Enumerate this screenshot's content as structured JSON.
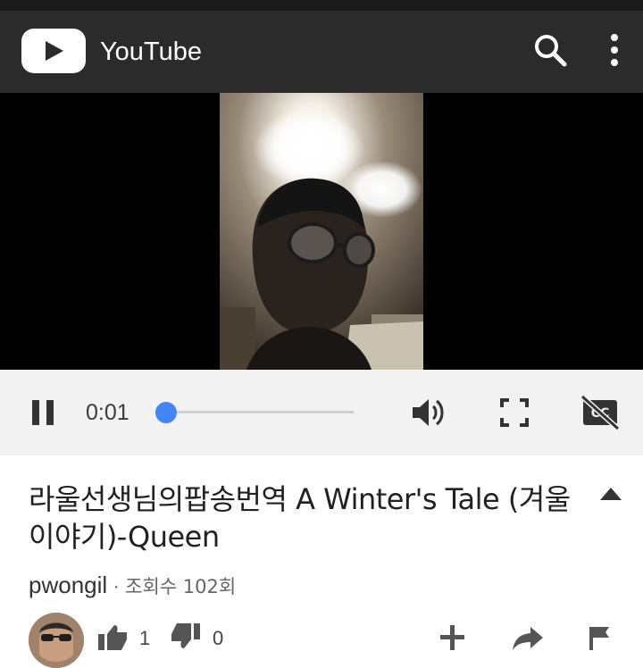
{
  "app_bar": {
    "title": "YouTube",
    "logo_icon": "youtube-play-icon",
    "search_icon": "search-icon",
    "more_icon": "more-vert-icon",
    "background": "#2b2b2b"
  },
  "player": {
    "current_time": "0:01",
    "progress": 0.0,
    "accent": "#4285f4",
    "pause_icon": "pause-icon",
    "volume_icon": "volume-icon",
    "fullscreen_icon": "fullscreen-icon",
    "captions_icon": "captions-off-icon"
  },
  "video": {
    "title": "라울선생님의팝송번역 A Winter's Tale (겨울이야기)-Queen",
    "channel": "pwongil",
    "separator": "·",
    "views": "조회수 102회"
  },
  "actions": {
    "likes": "1",
    "dislikes": "0",
    "like_icon": "thumb-up-icon",
    "dislike_icon": "thumb-down-icon",
    "add_icon": "add-to-playlist-icon",
    "share_icon": "share-icon",
    "flag_icon": "flag-icon"
  }
}
